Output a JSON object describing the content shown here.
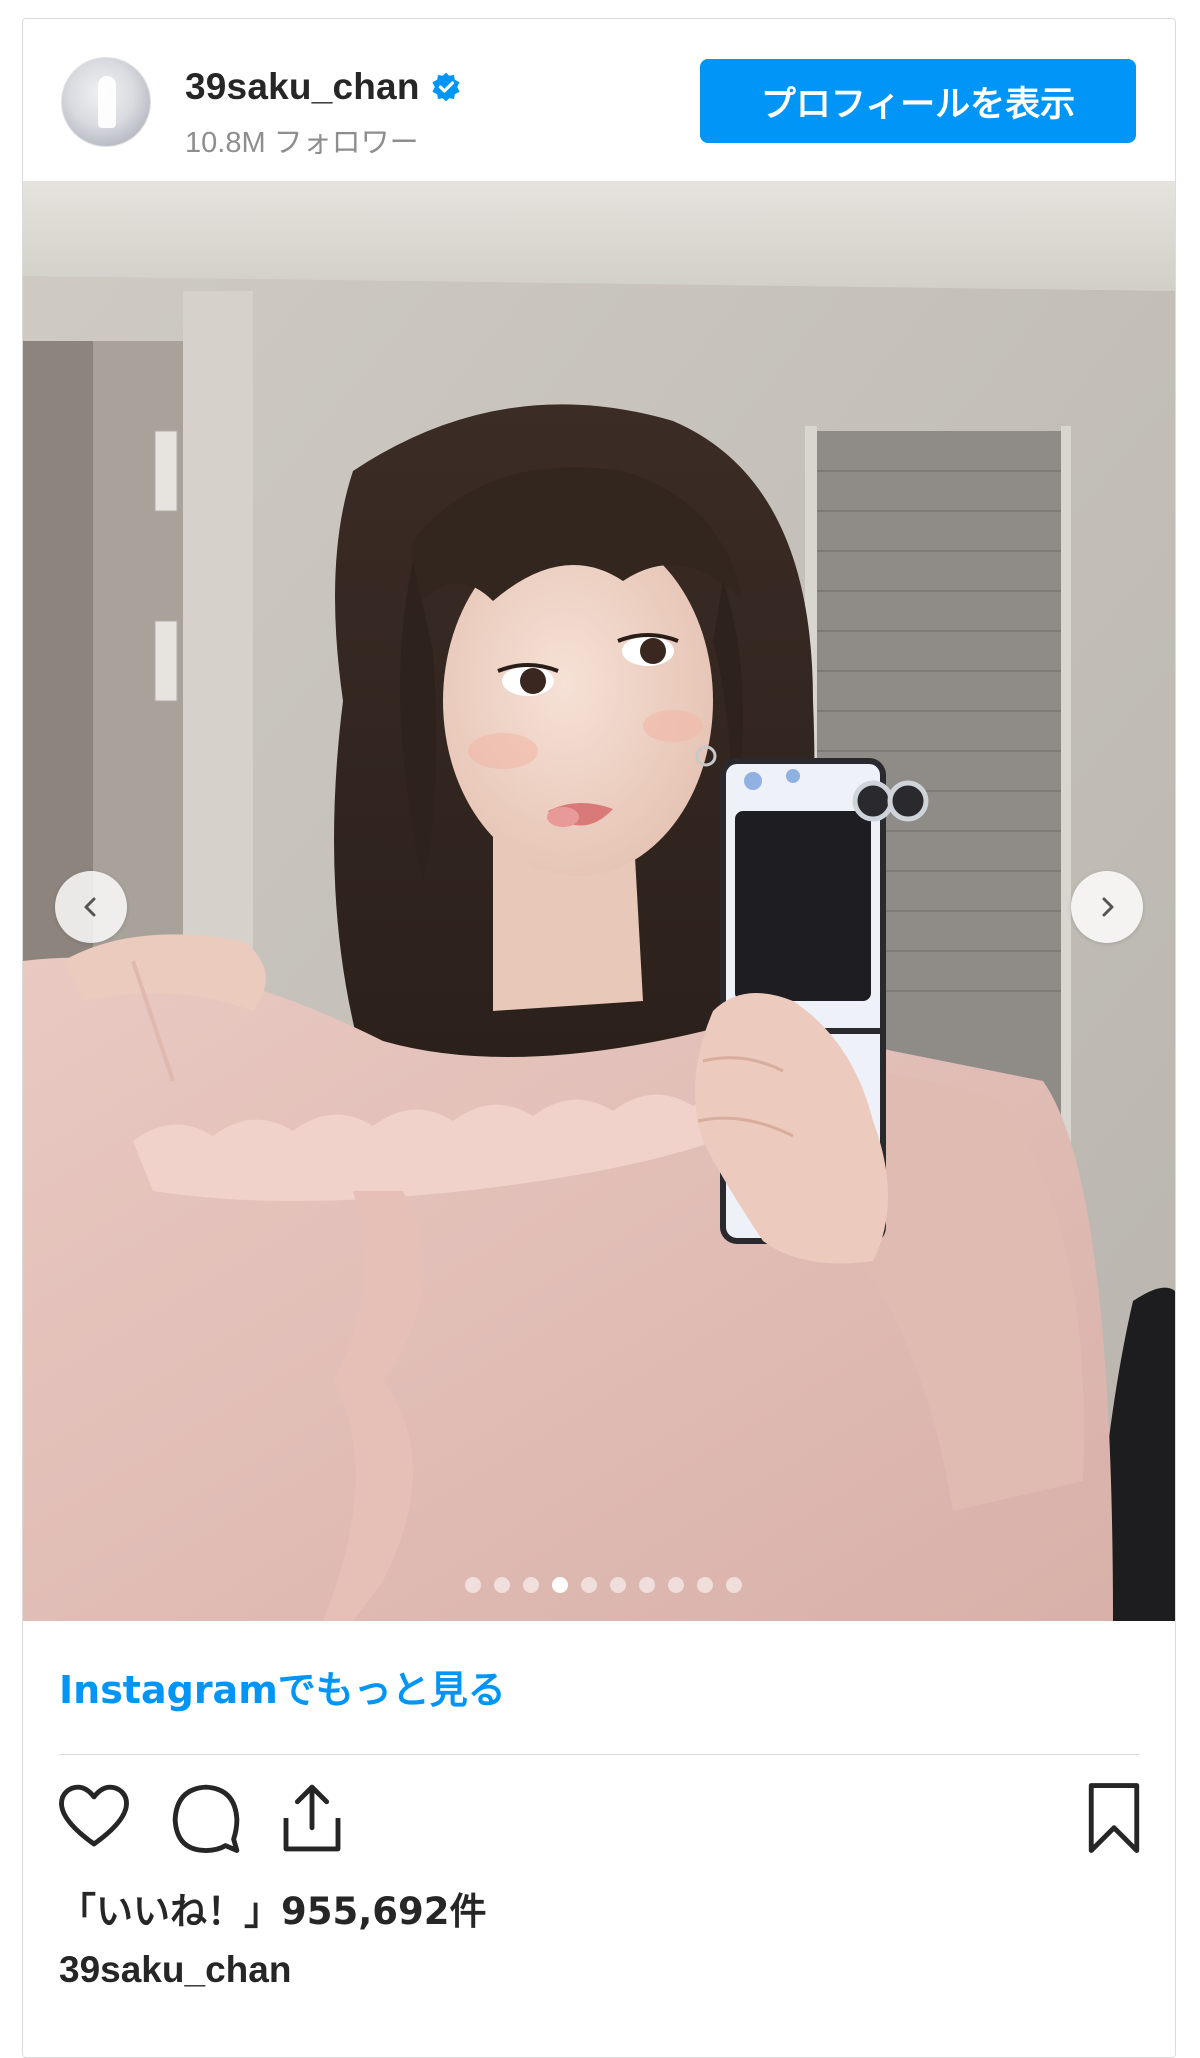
{
  "header": {
    "username": "39saku_chan",
    "followers": "10.8M フォロワー",
    "profile_button": "プロフィールを表示",
    "verified_icon": "verified-badge-icon"
  },
  "media": {
    "carousel_total": 10,
    "carousel_active": 4,
    "prev_icon": "chevron-left-icon",
    "next_icon": "chevron-right-icon"
  },
  "footer": {
    "more_link": "Instagramでもっと見る",
    "likes": "「いいね！」955,692件",
    "caption_username": "39saku_chan"
  },
  "colors": {
    "accent": "#0095f6",
    "text": "#262626",
    "muted": "#8e8e8e",
    "border": "#dbdbdb"
  }
}
